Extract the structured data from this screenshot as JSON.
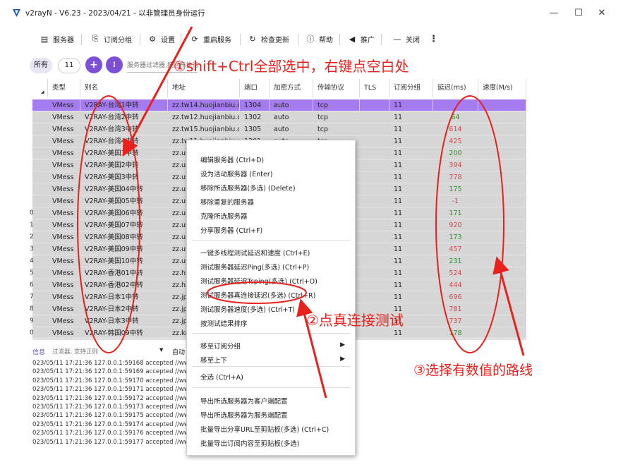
{
  "window": {
    "title": "v2rayN - V6.23 - 2023/04/21 - 以非管理员身份运行",
    "minimize": "—",
    "maximize": "☐",
    "close": "✕"
  },
  "toolbar": {
    "servers": "服务器",
    "subscription": "订阅分组",
    "settings": "设置",
    "restart": "重启服务",
    "check_update": "检查更新",
    "help": "帮助",
    "promote": "推广",
    "close": "关闭",
    "more": "⋮"
  },
  "filter": {
    "all_label": "所有",
    "count": "11",
    "add_label": "+",
    "sort_label": "⁞",
    "search_placeholder": "服务器过滤器,按回车执行"
  },
  "table": {
    "headers": [
      "类型",
      "别名",
      "地址",
      "端口",
      "加密方式",
      "传输协议",
      "TLS",
      "订阅分组",
      "延迟(ms)",
      "速度(M/s)"
    ],
    "rows": [
      {
        "num": "",
        "type": "VMess",
        "alias": "V2RAY-台湾1中转",
        "addr": "zz.tw14.huojianbiu.cn",
        "port": "1304",
        "enc": "auto",
        "net": "tcp",
        "sub": "11",
        "delay": ""
      },
      {
        "num": "",
        "type": "VMess",
        "alias": "V2RAY-台湾2中转",
        "addr": "zz.tw12.huojianbiu.cn",
        "port": "1302",
        "enc": "auto",
        "net": "tcp",
        "sub": "11",
        "delay": "64"
      },
      {
        "num": "",
        "type": "VMess",
        "alias": "V2RAY-台湾3中转",
        "addr": "zz.tw15.huojianbiu.cn",
        "port": "1305",
        "enc": "auto",
        "net": "tcp",
        "sub": "11",
        "delay": "614"
      },
      {
        "num": "",
        "type": "VMess",
        "alias": "V2RAY-台湾4中转",
        "addr": "zz.tw11.huojianbiu.cn",
        "port": "1301",
        "enc": "auto",
        "net": "tcp",
        "sub": "11",
        "delay": "425"
      },
      {
        "num": "",
        "type": "VMess",
        "alias": "V2RAY-美国1中转",
        "addr": "zz.us",
        "port": "",
        "enc": "",
        "net": "",
        "sub": "11",
        "delay": "200"
      },
      {
        "num": "",
        "type": "VMess",
        "alias": "V2RAY-美国2中转",
        "addr": "zz.us",
        "port": "",
        "enc": "",
        "net": "",
        "sub": "11",
        "delay": "394"
      },
      {
        "num": "",
        "type": "VMess",
        "alias": "V2RAY-美国3中转",
        "addr": "zz.us",
        "port": "",
        "enc": "",
        "net": "",
        "sub": "11",
        "delay": "778"
      },
      {
        "num": "",
        "type": "VMess",
        "alias": "V2RAY-美国04中转",
        "addr": "zz.us",
        "port": "",
        "enc": "",
        "net": "",
        "sub": "11",
        "delay": "175"
      },
      {
        "num": "",
        "type": "VMess",
        "alias": "V2RAY-美国05中转",
        "addr": "zz.us",
        "port": "",
        "enc": "",
        "net": "",
        "sub": "11",
        "delay": "-1"
      },
      {
        "num": "0",
        "type": "VMess",
        "alias": "V2RAY-美国06中转",
        "addr": "zz.us",
        "port": "",
        "enc": "",
        "net": "",
        "sub": "11",
        "delay": "171"
      },
      {
        "num": "1",
        "type": "VMess",
        "alias": "V2RAY-美国07中转",
        "addr": "zz.us",
        "port": "",
        "enc": "",
        "net": "",
        "sub": "11",
        "delay": "920"
      },
      {
        "num": "2",
        "type": "VMess",
        "alias": "V2RAY-美国08中转",
        "addr": "zz.us",
        "port": "",
        "enc": "",
        "net": "",
        "sub": "11",
        "delay": "173"
      },
      {
        "num": "3",
        "type": "VMess",
        "alias": "V2RAY-美国09中转",
        "addr": "zz.us",
        "port": "",
        "enc": "",
        "net": "",
        "sub": "11",
        "delay": "457"
      },
      {
        "num": "4",
        "type": "VMess",
        "alias": "V2RAY-美国10中转",
        "addr": "zz.us",
        "port": "",
        "enc": "",
        "net": "",
        "sub": "11",
        "delay": "231"
      },
      {
        "num": "5",
        "type": "VMess",
        "alias": "V2RAY-香港01中转",
        "addr": "zz.hk",
        "port": "",
        "enc": "",
        "net": "",
        "sub": "11",
        "delay": "524"
      },
      {
        "num": "6",
        "type": "VMess",
        "alias": "V2RAY-香港02中转",
        "addr": "zz.hk",
        "port": "",
        "enc": "",
        "net": "",
        "sub": "11",
        "delay": "444"
      },
      {
        "num": "7",
        "type": "VMess",
        "alias": "V2RAY-日本1中转",
        "addr": "zz.jp",
        "port": "",
        "enc": "",
        "net": "",
        "sub": "11",
        "delay": "696"
      },
      {
        "num": "8",
        "type": "VMess",
        "alias": "V2RAY-日本2中转",
        "addr": "zz.jp",
        "port": "",
        "enc": "",
        "net": "",
        "sub": "11",
        "delay": "781"
      },
      {
        "num": "9",
        "type": "VMess",
        "alias": "V2RAY-日本3中转",
        "addr": "zz.jp",
        "port": "",
        "enc": "",
        "net": "",
        "sub": "11",
        "delay": "737"
      },
      {
        "num": "0",
        "type": "VMess",
        "alias": "V2RAY-韩国09中转",
        "addr": "zz.kr",
        "port": "",
        "enc": "",
        "net": "",
        "sub": "11",
        "delay": "178"
      }
    ]
  },
  "log": {
    "label": "信息",
    "filter_placeholder": "过滤器, 支持正则",
    "auto_label": "自动",
    "lines": [
      "023/05/11 17:21:36 127.0.0.1:59168 accepted //www.gc",
      "023/05/11 17:21:36 127.0.0.1:59169 accepted //www.gc",
      "023/05/11 17:21:36 127.0.0.1:59170 accepted //www.gc",
      "023/05/11 17:21:36 127.0.0.1:59171 accepted //www.gc",
      "023/05/11 17:21:36 127.0.0.1:59172 accepted //www.gc",
      "023/05/11 17:21:36 127.0.0.1:59173 accepted //www.gc",
      "023/05/11 17:21:36 127.0.0.1:59175 accepted //www.gc",
      "023/05/11 17:21:36 127.0.0.1:59174 accepted //www.gc",
      "023/05/11 17:21:36 127.0.0.1:59176 accepted //www.gc",
      "023/05/11 17:21:36 127.0.0.1:59177 accepted //www.gc"
    ]
  },
  "context_menu": {
    "items": [
      "编辑服务器 (Ctrl+D)",
      "设为活动服务器 (Enter)",
      "移除所选服务器(多选) (Delete)",
      "移除重复的服务器",
      "克隆所选服务器",
      "分享服务器 (Ctrl+F)",
      "一键多线程测试延迟和速度 (Ctrl+E)",
      "测试服务器延迟Ping(多选) (Ctrl+P)",
      "测试服务器延迟Tcping(多选) (Ctrl+O)",
      "测试服务器真连接延迟(多选) (Ctrl+R)",
      "测试服务器速度(多选) (Ctrl+T)",
      "按测试结果排序",
      "移至订阅分组",
      "移至上下",
      "全选 (Ctrl+A)",
      "导出所选服务器为客户端配置",
      "导出所选服务器为服务端配置",
      "批量导出分享URL至剪贴板(多选) (Ctrl+C)",
      "批量导出订阅内容至剪贴板(多选)"
    ],
    "submenu_arrow": "▶"
  },
  "annotations": {
    "step1": "①shift+Ctrl全部选中，右键点空白处",
    "step2": "②点真连接测试",
    "step3": "③选择有数值的路线"
  },
  "colors": {
    "selected_row": "#a57cf0",
    "grid_row": "#d6d6d6",
    "accent": "#7b4fd6",
    "delay_green": "#2a9a2a",
    "delay_red": "#d24a4a",
    "annotation_red": "#e8211c"
  }
}
